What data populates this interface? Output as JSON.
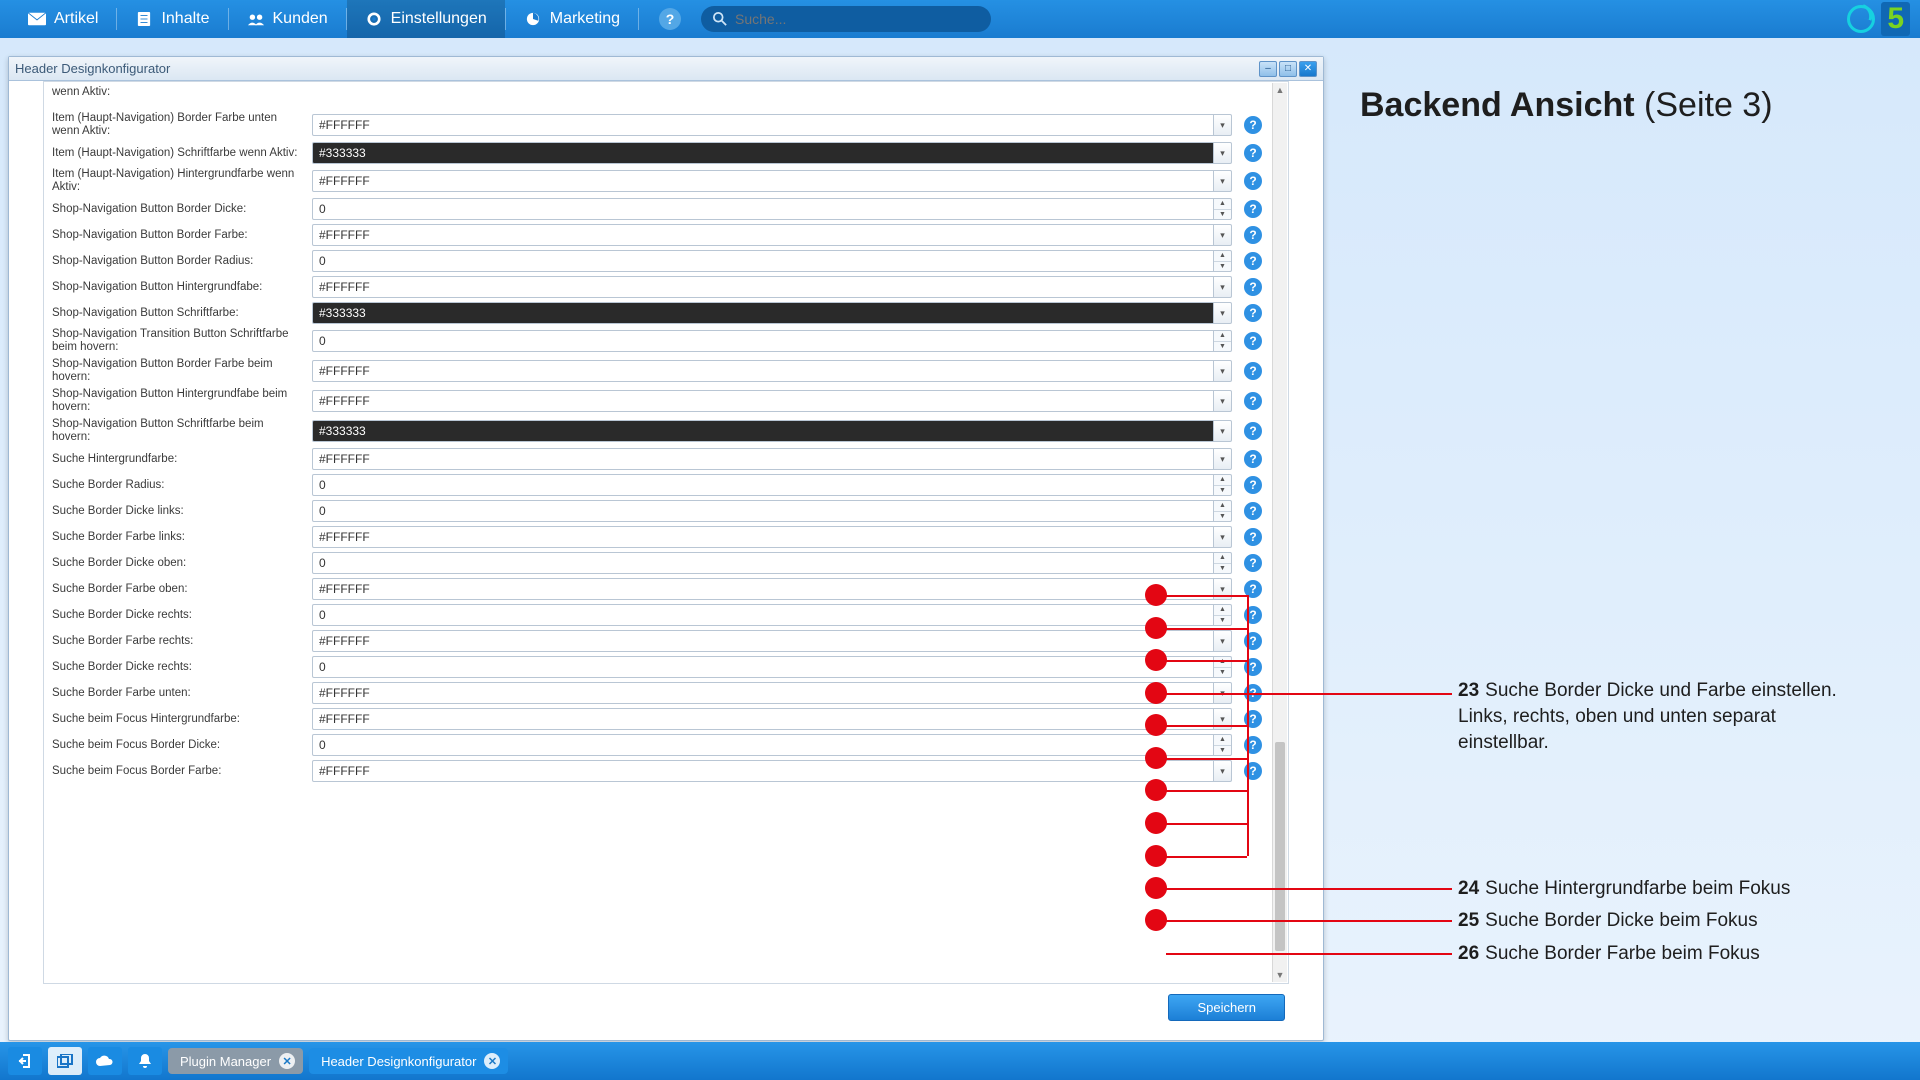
{
  "topnav": {
    "items": [
      {
        "label": "Artikel"
      },
      {
        "label": "Inhalte"
      },
      {
        "label": "Kunden"
      },
      {
        "label": "Einstellungen"
      },
      {
        "label": "Marketing"
      }
    ],
    "search_placeholder": "Suche..."
  },
  "window": {
    "title": "Header Designkonfigurator",
    "save_label": "Speichern"
  },
  "fields": [
    {
      "label": "wenn Aktiv:",
      "value": "",
      "kind": "color",
      "partial": true
    },
    {
      "label": "Item (Haupt-Navigation) Border Farbe unten wenn Aktiv:",
      "value": "#FFFFFF",
      "kind": "color"
    },
    {
      "label": "Item (Haupt-Navigation) Schriftfarbe wenn Aktiv:",
      "value": "#333333",
      "kind": "color",
      "dark": true
    },
    {
      "label": "Item (Haupt-Navigation) Hintergrundfarbe wenn Aktiv:",
      "value": "#FFFFFF",
      "kind": "color"
    },
    {
      "label": "Shop-Navigation Button Border Dicke:",
      "value": "0",
      "kind": "number"
    },
    {
      "label": "Shop-Navigation Button Border Farbe:",
      "value": "#FFFFFF",
      "kind": "color"
    },
    {
      "label": "Shop-Navigation Button Border Radius:",
      "value": "0",
      "kind": "number"
    },
    {
      "label": "Shop-Navigation Button Hintergrundfabe:",
      "value": "#FFFFFF",
      "kind": "color"
    },
    {
      "label": "Shop-Navigation Button Schriftfarbe:",
      "value": "#333333",
      "kind": "color",
      "dark": true
    },
    {
      "label": "Shop-Navigation Transition Button Schriftfarbe beim hovern:",
      "value": "0",
      "kind": "number"
    },
    {
      "label": "Shop-Navigation Button Border Farbe beim hovern:",
      "value": "#FFFFFF",
      "kind": "color"
    },
    {
      "label": "Shop-Navigation Button Hintergrundfabe beim hovern:",
      "value": "#FFFFFF",
      "kind": "color"
    },
    {
      "label": "Shop-Navigation Button Schriftfarbe beim hovern:",
      "value": "#333333",
      "kind": "color",
      "dark": true
    },
    {
      "label": "Suche Hintergrundfarbe:",
      "value": "#FFFFFF",
      "kind": "color"
    },
    {
      "label": "Suche Border Radius:",
      "value": "0",
      "kind": "number"
    },
    {
      "label": "Suche Border Dicke links:",
      "value": "0",
      "kind": "number"
    },
    {
      "label": "Suche Border Farbe links:",
      "value": "#FFFFFF",
      "kind": "color"
    },
    {
      "label": "Suche Border Dicke oben:",
      "value": "0",
      "kind": "number"
    },
    {
      "label": "Suche Border Farbe oben:",
      "value": "#FFFFFF",
      "kind": "color"
    },
    {
      "label": "Suche Border Dicke rechts:",
      "value": "0",
      "kind": "number"
    },
    {
      "label": "Suche Border Farbe rechts:",
      "value": "#FFFFFF",
      "kind": "color"
    },
    {
      "label": "Suche Border Dicke rechts:",
      "value": "0",
      "kind": "number"
    },
    {
      "label": "Suche Border Farbe unten:",
      "value": "#FFFFFF",
      "kind": "color"
    },
    {
      "label": "Suche beim Focus Hintergrundfarbe:",
      "value": "#FFFFFF",
      "kind": "color"
    },
    {
      "label": "Suche beim Focus Border Dicke:",
      "value": "0",
      "kind": "number"
    },
    {
      "label": "Suche beim Focus Border Farbe:",
      "value": "#FFFFFF",
      "kind": "color"
    }
  ],
  "taskbar": {
    "pills": [
      {
        "label": "Plugin Manager",
        "style": "grey"
      },
      {
        "label": "Header Designkonfigurator",
        "style": "blue"
      }
    ]
  },
  "annotation": {
    "heading_bold": "Backend Ansicht",
    "heading_rest": " (Seite 3)",
    "notes": [
      {
        "num": "23",
        "text": "Suche Border Dicke und Farbe einstellen. Links, rechts, oben und unten separat einstellbar."
      },
      {
        "num": "24",
        "text": "Suche Hintergrundfarbe beim Fokus"
      },
      {
        "num": "25",
        "text": "Suche Border Dicke beim Fokus"
      },
      {
        "num": "26",
        "text": "Suche Border Farbe beim Fokus"
      }
    ]
  },
  "scrollbar": {
    "thumb_top_pct": 74,
    "thumb_height_pct": 24
  }
}
